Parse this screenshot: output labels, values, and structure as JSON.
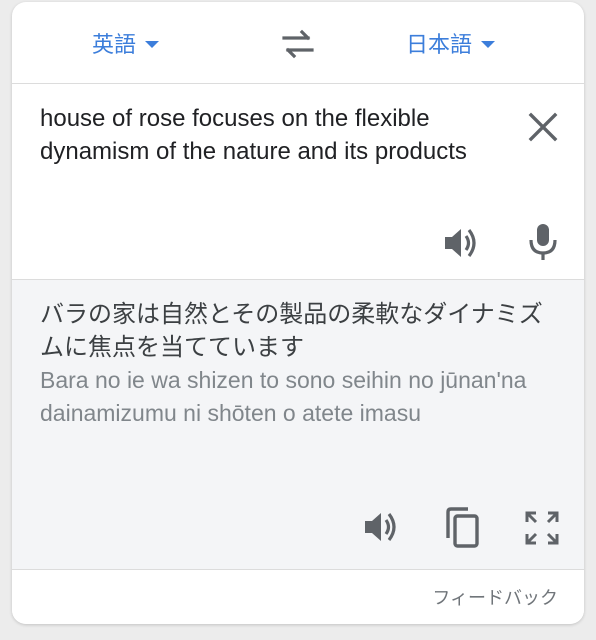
{
  "colors": {
    "accent": "#3c7edb",
    "icon": "#5f6368",
    "result_bg": "#f4f5f7"
  },
  "languages": {
    "source": "英語",
    "target": "日本語"
  },
  "source": {
    "text": "house of rose focuses on the flexible dynamism of the nature and its products"
  },
  "result": {
    "translation": "バラの家は自然とその製品の柔軟なダイナミズムに焦点を当てています",
    "romanization": "Bara no ie wa shizen to sono seihin no jūnan'na dainamizumu ni shōten o atete imasu"
  },
  "footer": {
    "feedback": "フィードバック"
  },
  "icons": [
    "swap-icon",
    "close-icon",
    "speaker-icon",
    "microphone-icon",
    "copy-icon",
    "fullscreen-icon"
  ]
}
